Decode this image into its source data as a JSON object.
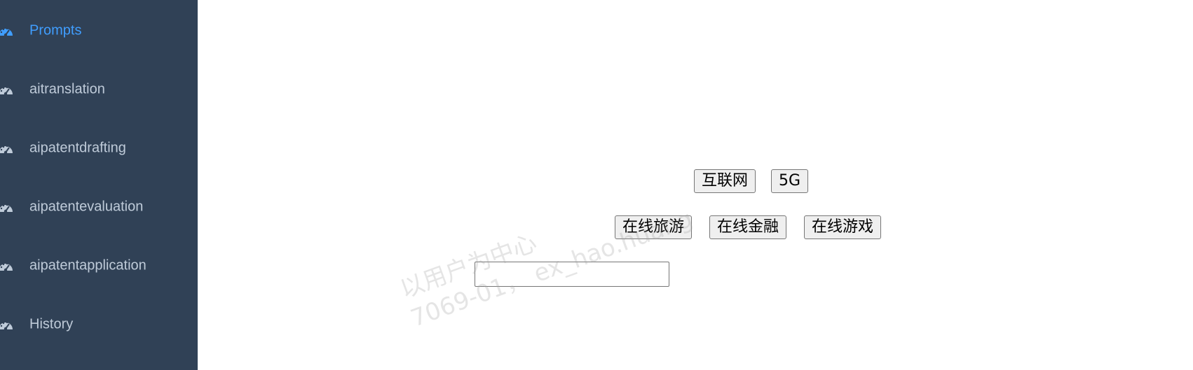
{
  "sidebar": {
    "items": [
      {
        "label": "Prompts",
        "icon": "dashboard-icon",
        "active": true
      },
      {
        "label": "aitranslation",
        "icon": "dashboard-icon"
      },
      {
        "label": "aipatentdrafting",
        "icon": "dashboard-icon"
      },
      {
        "label": "aipatentevaluation",
        "icon": "dashboard-icon"
      },
      {
        "label": "aipatentapplication",
        "icon": "dashboard-icon"
      },
      {
        "label": "History",
        "icon": "dashboard-icon"
      }
    ],
    "colors": {
      "background": "#304156",
      "text": "#bfcbd9",
      "active": "#409eff"
    }
  },
  "main": {
    "row1": [
      "互联网",
      "5G"
    ],
    "row2": [
      "在线旅游",
      "在线金融",
      "在线游戏"
    ],
    "input": {
      "value": "",
      "placeholder": ""
    }
  },
  "watermark": {
    "line1": "以用户为中心",
    "line2": "7069-01， ex_hao.huang"
  }
}
